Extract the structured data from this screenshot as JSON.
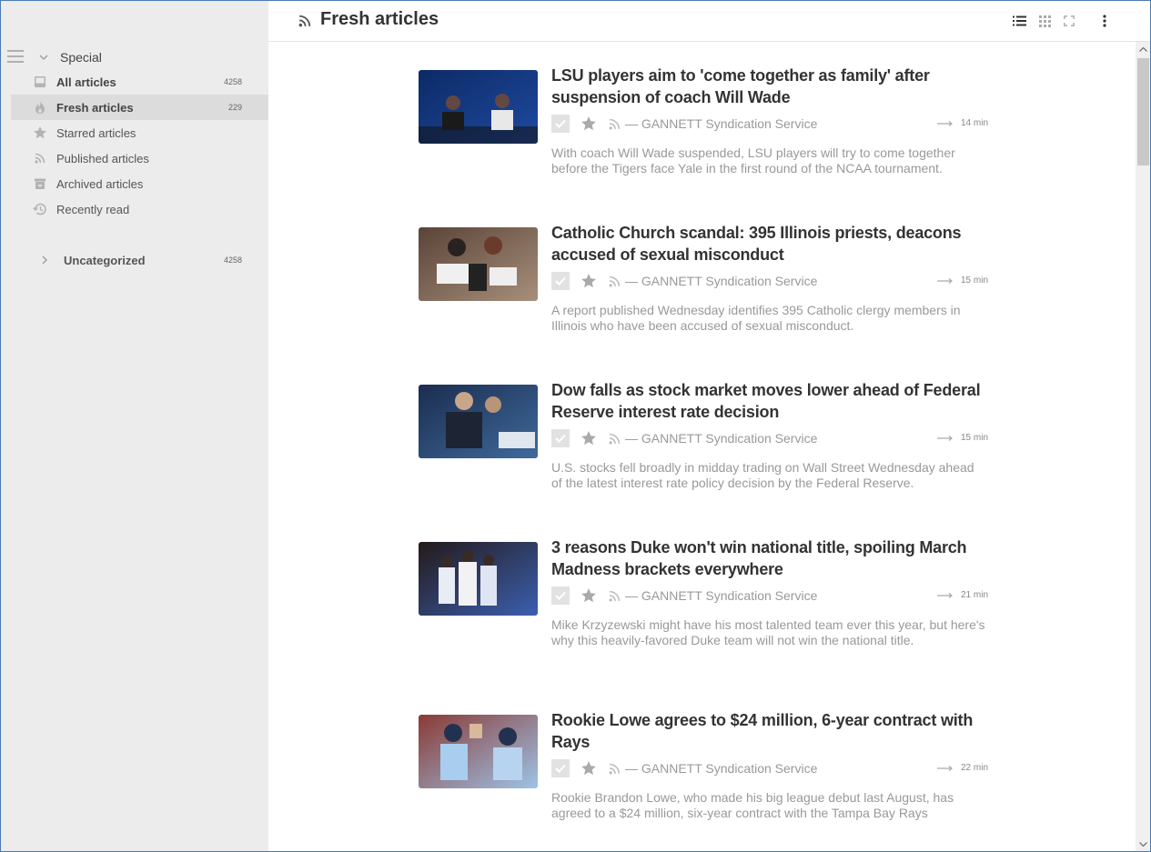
{
  "header": {
    "title": "Fresh articles"
  },
  "sidebar": {
    "special_label": "Special",
    "items": [
      {
        "label": "All articles",
        "count": "4258",
        "icon": "inbox-icon",
        "bold": true,
        "active": false
      },
      {
        "label": "Fresh articles",
        "count": "229",
        "icon": "flame-icon",
        "bold": true,
        "active": true
      },
      {
        "label": "Starred articles",
        "count": "",
        "icon": "star-icon",
        "bold": false,
        "active": false
      },
      {
        "label": "Published articles",
        "count": "",
        "icon": "rss-icon",
        "bold": false,
        "active": false
      },
      {
        "label": "Archived articles",
        "count": "",
        "icon": "archive-icon",
        "bold": false,
        "active": false
      },
      {
        "label": "Recently read",
        "count": "",
        "icon": "history-icon",
        "bold": false,
        "active": false
      }
    ],
    "category": {
      "label": "Uncategorized",
      "count": "4258"
    }
  },
  "articles": [
    {
      "title": "LSU players aim to 'come together as family' after suspension of coach Will Wade",
      "source": "— GANNETT Syndication Service",
      "read_time": "14 min",
      "excerpt": "With coach Will Wade suspended, LSU players will try to come together before the Tigers face Yale in the first round of the NCAA tournament.",
      "thumb_colors": [
        "#0c2a66",
        "#1f4aa0"
      ]
    },
    {
      "title": "Catholic Church scandal: 395 Illinois priests, deacons accused of sexual misconduct",
      "source": "— GANNETT Syndication Service",
      "read_time": "15 min",
      "excerpt": "A report published Wednesday identifies 395 Catholic clergy members in Illinois who have been accused of sexual misconduct.",
      "thumb_colors": [
        "#5a4438",
        "#a88f7b"
      ]
    },
    {
      "title": "Dow falls as stock market moves lower ahead of Federal Reserve interest rate decision",
      "source": "— GANNETT Syndication Service",
      "read_time": "15 min",
      "excerpt": "U.S. stocks fell broadly in midday trading on Wall Street Wednesday ahead of the latest interest rate policy decision by the Federal Reserve.",
      "thumb_colors": [
        "#1b2d4f",
        "#3f6a9c"
      ]
    },
    {
      "title": "3 reasons Duke won't win national title, spoiling March Madness brackets everywhere",
      "source": "— GANNETT Syndication Service",
      "read_time": "21 min",
      "excerpt": "Mike Krzyzewski might have his most talented team ever this year, but here's why this heavily-favored Duke team will not win the national title.",
      "thumb_colors": [
        "#241a1a",
        "#3b5fb0"
      ]
    },
    {
      "title": "Rookie Lowe agrees to $24 million, 6-year contract with Rays",
      "source": "— GANNETT Syndication Service",
      "read_time": "22 min",
      "excerpt": "Rookie Brandon Lowe, who made his big league debut last August, has agreed to a $24 million, six-year contract with the Tampa Bay Rays",
      "thumb_colors": [
        "#8a3a34",
        "#9dc3e8"
      ]
    }
  ]
}
